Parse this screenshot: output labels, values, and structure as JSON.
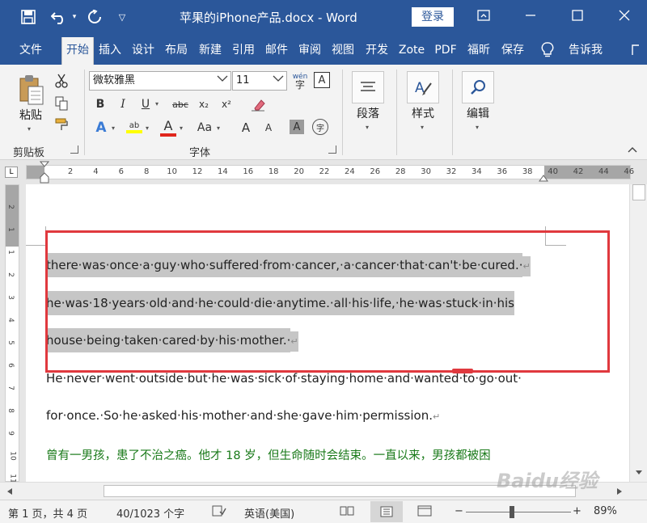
{
  "window": {
    "title": "苹果的iPhone产品.docx  -  Word",
    "login_label": "登录"
  },
  "tabs": [
    {
      "label": "文件"
    },
    {
      "label": "开始"
    },
    {
      "label": "插入"
    },
    {
      "label": "设计"
    },
    {
      "label": "布局"
    },
    {
      "label": "新建"
    },
    {
      "label": "引用"
    },
    {
      "label": "邮件"
    },
    {
      "label": "审阅"
    },
    {
      "label": "视图"
    },
    {
      "label": "开发"
    },
    {
      "label": "Zote"
    },
    {
      "label": "PDF"
    },
    {
      "label": "福昕"
    },
    {
      "label": "保存"
    }
  ],
  "tell_me": "告诉我",
  "ribbon": {
    "clipboard": {
      "paste_label": "粘贴",
      "group_label": "剪贴板"
    },
    "font": {
      "font_name": "微软雅黑",
      "font_size": "11",
      "group_label": "字体",
      "bold": "B",
      "italic": "I",
      "underline": "U",
      "strike": "abc",
      "subscript": "x₂",
      "superscript": "x²",
      "text_effect": "A",
      "highlight": "ab",
      "font_color": "A",
      "change_case": "Aa",
      "grow": "A",
      "shrink": "A",
      "shading": "A",
      "enclose": "字",
      "phonetic": "wén",
      "border": "A"
    },
    "paragraph": {
      "label": "段落"
    },
    "styles": {
      "label": "样式"
    },
    "editing": {
      "label": "编辑"
    }
  },
  "ruler": {
    "corner": "L",
    "ticks": [
      "2",
      "4",
      "6",
      "8",
      "10",
      "12",
      "14",
      "16",
      "18",
      "20",
      "22",
      "24",
      "26",
      "28",
      "30",
      "32",
      "34",
      "36",
      "38",
      "40",
      "42",
      "44",
      "46"
    ],
    "vticks": [
      "2",
      "1",
      "1",
      "2",
      "3",
      "4",
      "5",
      "6",
      "7",
      "8",
      "9",
      "10",
      "11"
    ]
  },
  "document": {
    "lines": [
      {
        "text": "there·was·once·a·guy·who·suffered·from·cancer,·a·cancer·that·can't·be·cured.·",
        "mark": "↵",
        "highlight": true
      },
      {
        "text": "he·was·18·years·old·and·he·could·die·anytime.·all·his·life,·he·was·stuck·in·his",
        "mark": "",
        "highlight": true
      },
      {
        "text": "house·being·taken·cared·by·his·mother.·",
        "mark": "↵",
        "highlight": true
      },
      {
        "text": "He·never·went·outside·but·he·was·sick·of·staying·home·and·wanted·to·go·out·",
        "mark": "",
        "highlight": false
      },
      {
        "text": "for·once.·So·he·asked·his·mother·and·she·gave·him·permission.",
        "mark": "↵",
        "highlight": false
      },
      {
        "text": "曾有一男孩，患了不治之癌。他才 18 岁，但生命随时会结束。一直以来，男孩都被困",
        "mark": "",
        "highlight": false
      }
    ]
  },
  "status": {
    "page": "第 1 页，共 4 页",
    "words": "40/1023 个字",
    "language": "英语(美国)",
    "zoom": "89%",
    "zoom_minus": "−",
    "zoom_plus": "+"
  },
  "watermark": "Baidu经验"
}
